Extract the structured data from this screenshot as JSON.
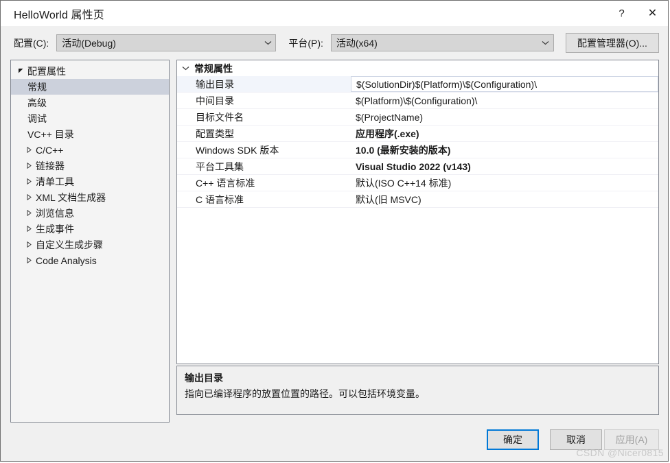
{
  "window": {
    "title": "HelloWorld 属性页",
    "help_icon": "question-mark-icon",
    "close_icon": "close-icon"
  },
  "configbar": {
    "config_label": "配置(C):",
    "config_value": "活动(Debug)",
    "platform_label": "平台(P):",
    "platform_value": "活动(x64)",
    "config_manager_button": "配置管理器(O)..."
  },
  "tree": {
    "root": {
      "label": "配置属性",
      "expanded": true
    },
    "items": [
      {
        "label": "常规",
        "selected": true,
        "expandable": false
      },
      {
        "label": "高级",
        "selected": false,
        "expandable": false
      },
      {
        "label": "调试",
        "selected": false,
        "expandable": false
      },
      {
        "label": "VC++ 目录",
        "selected": false,
        "expandable": false
      },
      {
        "label": "C/C++",
        "selected": false,
        "expandable": true
      },
      {
        "label": "链接器",
        "selected": false,
        "expandable": true
      },
      {
        "label": "清单工具",
        "selected": false,
        "expandable": true
      },
      {
        "label": "XML 文档生成器",
        "selected": false,
        "expandable": true
      },
      {
        "label": "浏览信息",
        "selected": false,
        "expandable": true
      },
      {
        "label": "生成事件",
        "selected": false,
        "expandable": true
      },
      {
        "label": "自定义生成步骤",
        "selected": false,
        "expandable": true
      },
      {
        "label": "Code Analysis",
        "selected": false,
        "expandable": true
      }
    ]
  },
  "grid": {
    "section_title": "常规属性",
    "section_expanded": true,
    "rows": [
      {
        "label": "输出目录",
        "value": "$(SolutionDir)$(Platform)\\$(Configuration)\\",
        "bold": false,
        "selected": true
      },
      {
        "label": "中间目录",
        "value": "$(Platform)\\$(Configuration)\\",
        "bold": false,
        "selected": false
      },
      {
        "label": "目标文件名",
        "value": "$(ProjectName)",
        "bold": false,
        "selected": false
      },
      {
        "label": "配置类型",
        "value": "应用程序(.exe)",
        "bold": true,
        "selected": false
      },
      {
        "label": "Windows SDK 版本",
        "value": "10.0 (最新安装的版本)",
        "bold": true,
        "selected": false
      },
      {
        "label": "平台工具集",
        "value": "Visual Studio 2022 (v143)",
        "bold": true,
        "selected": false
      },
      {
        "label": "C++ 语言标准",
        "value": "默认(ISO C++14 标准)",
        "bold": false,
        "selected": false
      },
      {
        "label": "C 语言标准",
        "value": "默认(旧 MSVC)",
        "bold": false,
        "selected": false
      }
    ]
  },
  "description": {
    "title": "输出目录",
    "text": "指向已编译程序的放置位置的路径。可以包括环境变量。"
  },
  "footer": {
    "ok": "确定",
    "cancel": "取消",
    "apply": "应用(A)",
    "apply_disabled": true
  },
  "watermark": "CSDN @Nicer0815",
  "colors": {
    "accent": "#0078d7",
    "tree_selection": "#ccd1dc",
    "dialog_bg": "#f0f0f0",
    "border": "#828790"
  }
}
